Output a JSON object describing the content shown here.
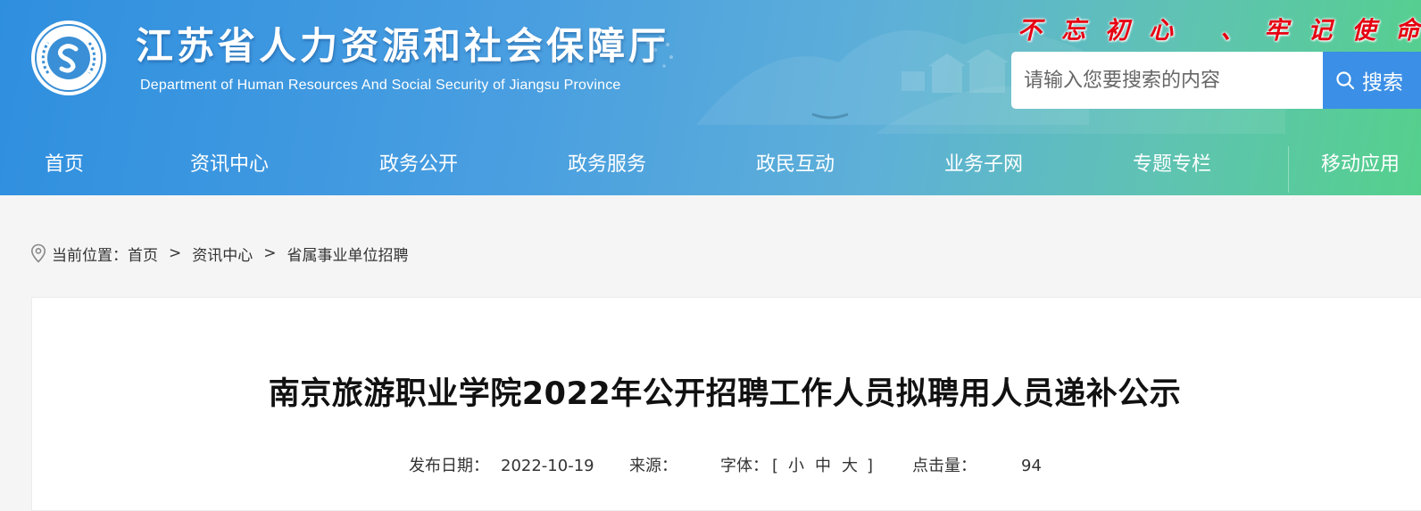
{
  "header": {
    "title": "江苏省人力资源和社会保障厅",
    "subtitle": "Department of Human Resources And Social Security of Jiangsu Province",
    "slogan": "不忘初心 、牢记使命",
    "logo_ring_text": "江苏省人力资源和社会保障厅"
  },
  "search": {
    "placeholder": "请输入您要搜索的内容",
    "button_label": "搜索"
  },
  "nav": {
    "items": [
      "首页",
      "资讯中心",
      "政务公开",
      "政务服务",
      "政民互动",
      "业务子网",
      "专题专栏",
      "移动应用"
    ]
  },
  "breadcrumb": {
    "label": "当前位置：",
    "items": [
      "首页",
      "资讯中心",
      "省属事业单位招聘"
    ],
    "separator": ">"
  },
  "article": {
    "title": "南京旅游职业学院2022年公开招聘工作人员拟聘用人员递补公示",
    "date_label": "发布日期：",
    "date": "2022-10-19",
    "source_label": "来源：",
    "font_label": "字体：",
    "font_open": "[",
    "font_small": "小",
    "font_medium": "中",
    "font_large": "大",
    "font_close": "]",
    "views_label": "点击量：",
    "views": "94"
  },
  "colors": {
    "slogan": "#e60012",
    "search_button": "#3b8fe6",
    "banner_start": "#2f8fdf",
    "banner_end": "#55d08c"
  },
  "icons": {
    "search": "search-icon",
    "location": "location-pin-icon",
    "logo": "site-logo"
  }
}
